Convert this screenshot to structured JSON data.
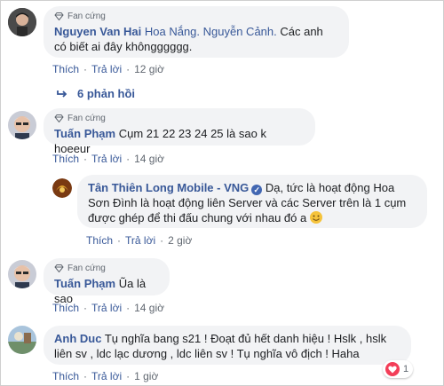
{
  "fan_badge": "Fan cứng",
  "actions": {
    "like": "Thích",
    "reply": "Trả lời"
  },
  "comments": [
    {
      "author": "Nguyen Van Hai",
      "mentions": "Hoa Nắng. Nguyễn Cảnh.",
      "text": " Các anh có biết ai đây khôngggggg.",
      "time": "12 giờ",
      "replies_label": "6 phản hồi"
    },
    {
      "author": "Tuấn Phạm",
      "text": " Cụm 21 22 23 24 25 là sao k hoeeur",
      "time": "14 giờ"
    },
    {
      "author": "Tân Thiên Long Mobile - VNG",
      "text": " Dạ, tức là hoạt động Hoa Sơn Đình là hoạt động liên Server và các Server trên là 1 cụm được ghép để thi đấu chung với nhau đó a ",
      "time": "2 giờ"
    },
    {
      "author": "Tuấn Phạm",
      "text": " Ũa là sao",
      "time": "14 giờ"
    },
    {
      "author": "Anh Duc",
      "text": " Tụ nghĩa bang s21 ! Đoạt đủ hết danh hiệu ! Hslk , hslk liên sv , ldc lạc dương , ldc liên sv ! Tụ nghĩa vô địch ! Haha",
      "time": "1 giờ",
      "reaction_count": "1"
    }
  ],
  "colors": {
    "link": "#385898",
    "bubble": "#f2f3f5",
    "meta": "#606770",
    "verified": "#4267b2",
    "heart": "#f33e58"
  }
}
